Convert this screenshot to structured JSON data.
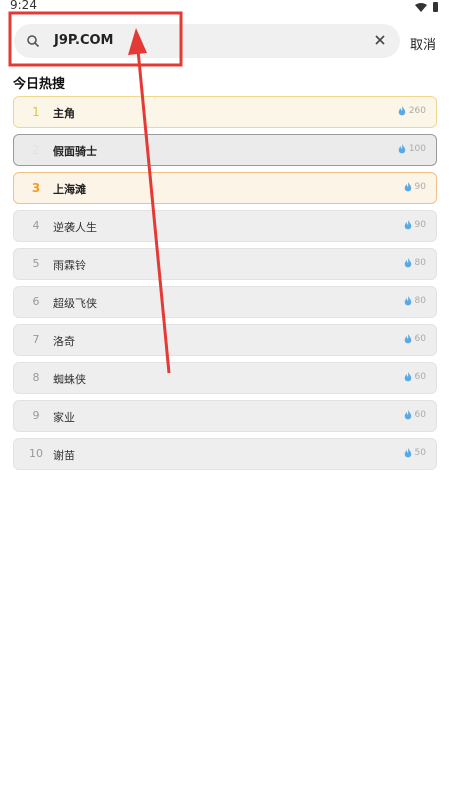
{
  "status": {
    "time": "9:24"
  },
  "search": {
    "value": "J9P.COM",
    "cancel_label": "取消"
  },
  "section": {
    "title": "今日热搜"
  },
  "items": [
    {
      "rank": "1",
      "title": "主角",
      "heat": "260"
    },
    {
      "rank": "2",
      "title": "假面骑士",
      "heat": "100"
    },
    {
      "rank": "3",
      "title": "上海滩",
      "heat": "90"
    },
    {
      "rank": "4",
      "title": "逆袭人生",
      "heat": "90"
    },
    {
      "rank": "5",
      "title": "雨霖铃",
      "heat": "80"
    },
    {
      "rank": "6",
      "title": "超级飞侠",
      "heat": "80"
    },
    {
      "rank": "7",
      "title": "洛奇",
      "heat": "60"
    },
    {
      "rank": "8",
      "title": "蜘蛛侠",
      "heat": "60"
    },
    {
      "rank": "9",
      "title": "家业",
      "heat": "60"
    },
    {
      "rank": "10",
      "title": "谢苗",
      "heat": "50"
    }
  ],
  "colors": {
    "highlight": "#e53935",
    "rank1": "#e8c23a",
    "rank3": "#f29c2b",
    "heat_icon": "#5aa9e6"
  }
}
